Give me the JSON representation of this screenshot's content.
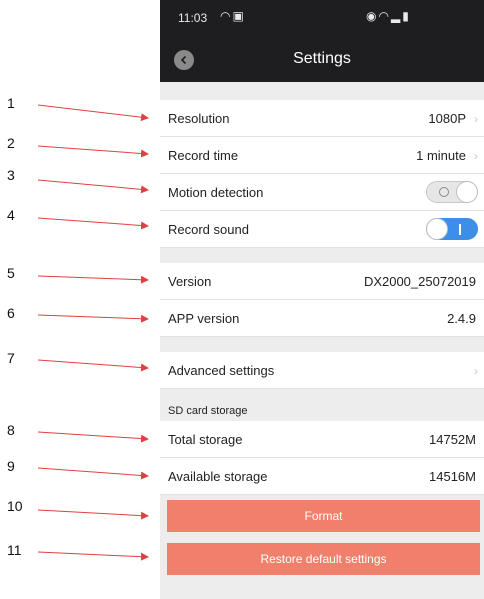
{
  "annotations": [
    "1",
    "2",
    "3",
    "4",
    "5",
    "6",
    "7",
    "8",
    "9",
    "10",
    "11"
  ],
  "status_bar": {
    "time": "11:03",
    "left_icons": "wifi-icon notification-icon",
    "right_icons": "alarm-icon wifi-icon signal-icon battery-icon"
  },
  "header": {
    "title": "Settings"
  },
  "settings": {
    "resolution": {
      "label": "Resolution",
      "value": "1080P"
    },
    "record_time": {
      "label": "Record time",
      "value": "1 minute"
    },
    "motion_detection": {
      "label": "Motion detection",
      "enabled": false
    },
    "record_sound": {
      "label": "Record sound",
      "enabled": true
    },
    "version": {
      "label": "Version",
      "value": "DX2000_25072019"
    },
    "app_version": {
      "label": "APP version",
      "value": "2.4.9"
    },
    "advanced": {
      "label": "Advanced settings"
    },
    "sd_caption": "SD card storage",
    "total_storage": {
      "label": "Total storage",
      "value": "14752M"
    },
    "available_storage": {
      "label": "Available storage",
      "value": "14516M"
    }
  },
  "buttons": {
    "format": "Format",
    "restore": "Restore default settings"
  },
  "colors": {
    "header_bg": "#1e1e20",
    "screen_bg": "#ededed",
    "action_button": "#f07f6b",
    "toggle_on": "#3c8ee6",
    "arrow": "#e04040"
  }
}
